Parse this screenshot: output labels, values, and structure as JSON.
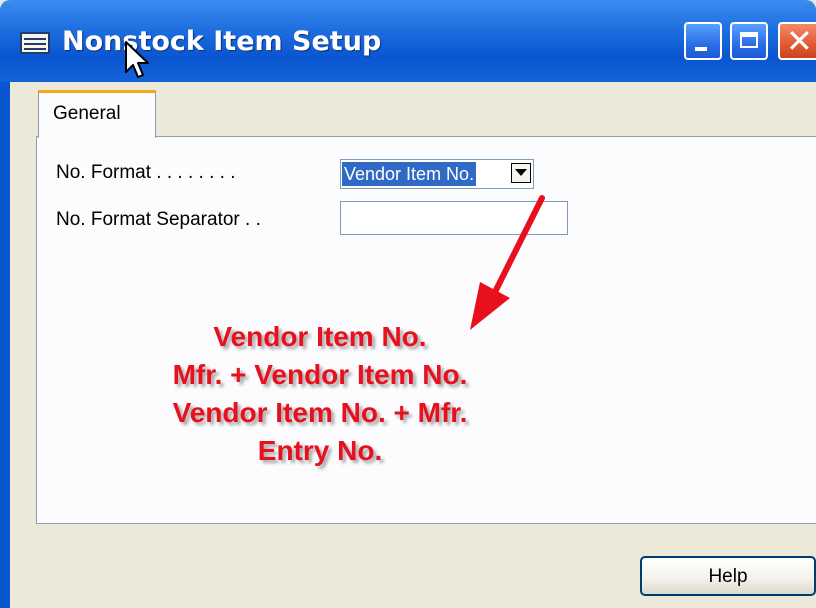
{
  "window": {
    "title": "Nonstock Item Setup",
    "icon": "table-icon",
    "title_color": "#1f6fe0"
  },
  "tabs": [
    {
      "label": "General",
      "active": true
    }
  ],
  "fields": {
    "no_format": {
      "label": "No. Format . . . . . . . .",
      "value": "Vendor Item No."
    },
    "no_format_separator": {
      "label": "No. Format Separator . .",
      "value": ""
    }
  },
  "annotation": {
    "color": "#e8101c",
    "lines": [
      "Vendor Item No.",
      "Mfr. + Vendor Item No.",
      "Vendor Item No. + Mfr.",
      "Entry No."
    ]
  },
  "buttons": {
    "help_label": "Help"
  }
}
